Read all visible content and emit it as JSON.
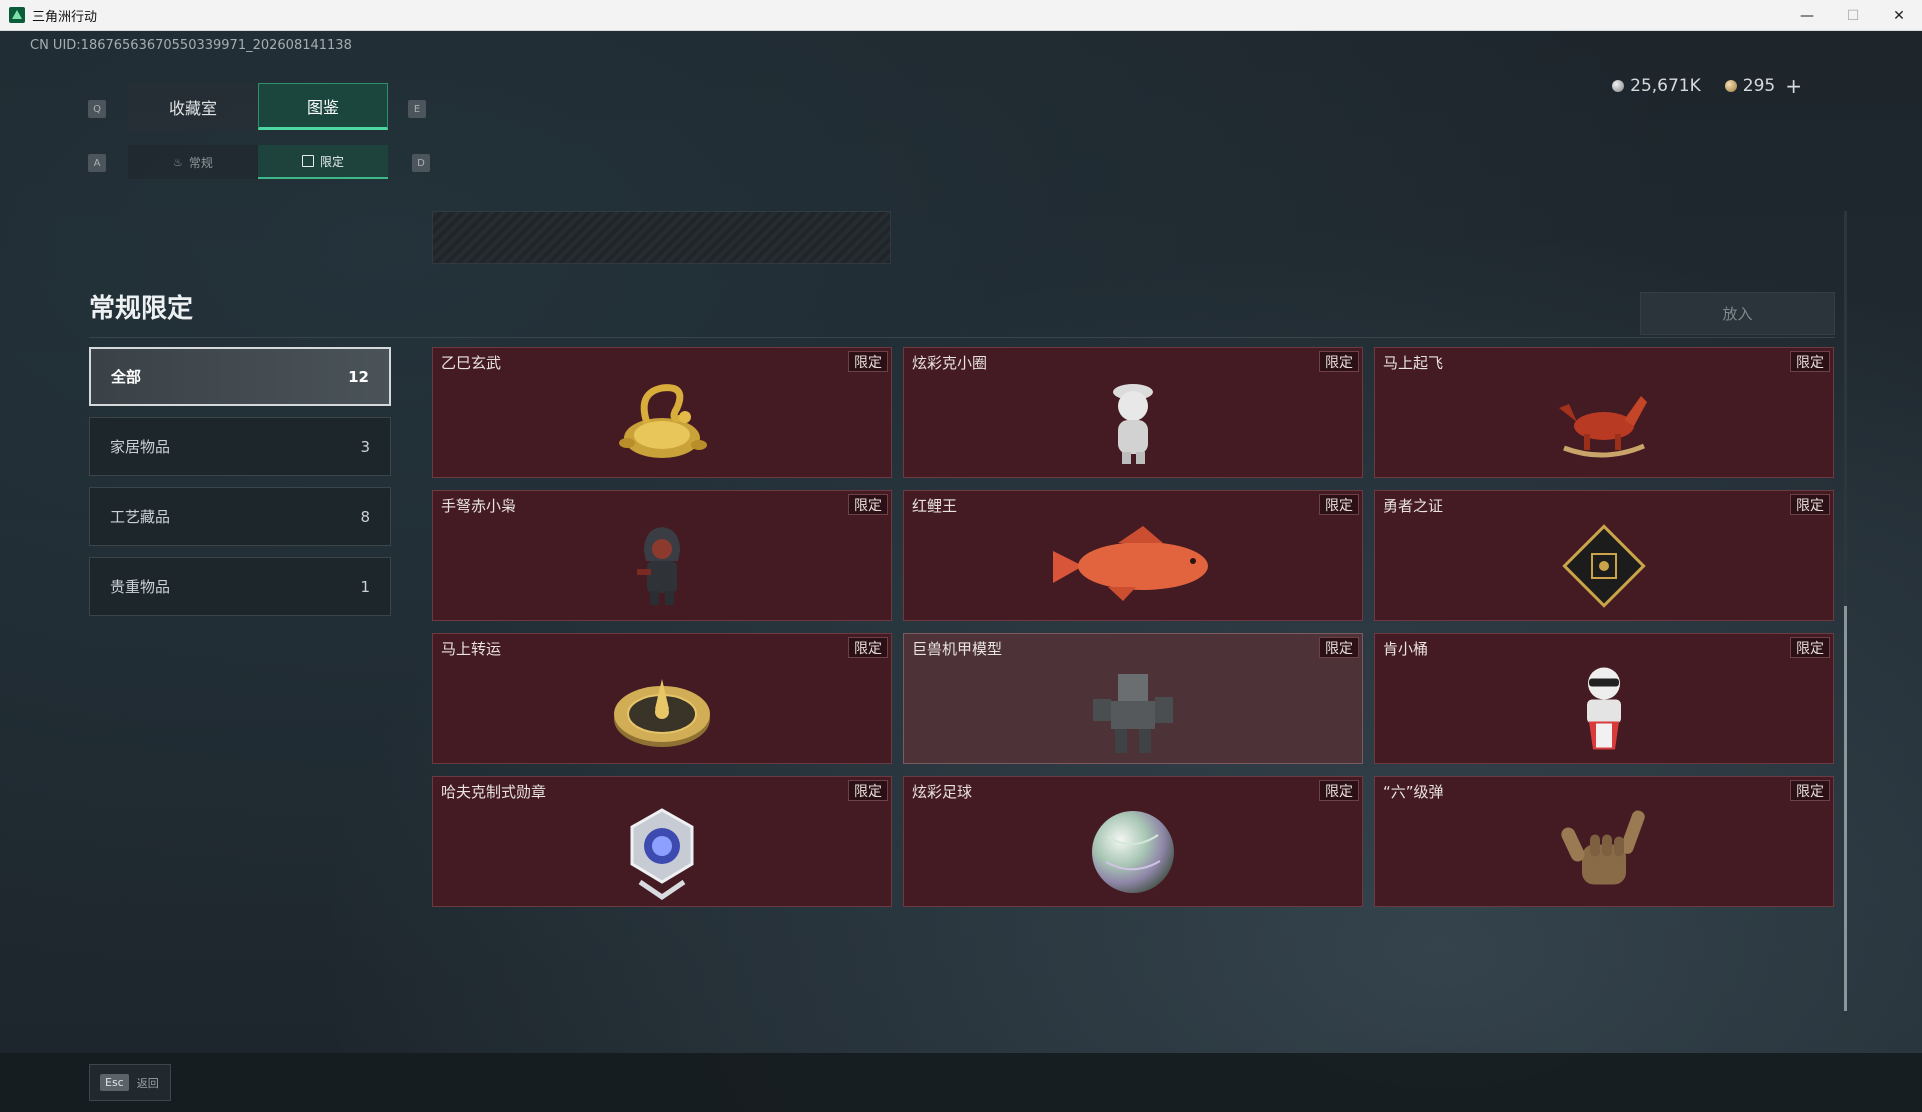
{
  "window": {
    "title": "三角洲行动",
    "minimize": "—",
    "maximize": "☐",
    "close": "✕"
  },
  "uid": "CN UID:18676563670550339971_202608141138",
  "currency": {
    "silver": "25,671K",
    "gold": "295",
    "plus": "+"
  },
  "keys": {
    "q": "Q",
    "e": "E",
    "a": "A",
    "d": "D"
  },
  "tabs": [
    {
      "label": "收藏室",
      "active": false
    },
    {
      "label": "图鉴",
      "active": true
    }
  ],
  "subtabs": [
    {
      "label": "常规",
      "icon": "flame-icon",
      "active": false
    },
    {
      "label": "限定",
      "icon": "picture-icon",
      "active": true
    }
  ],
  "section_title": "常规限定",
  "put_button": "放入",
  "categories": [
    {
      "label": "全部",
      "count": "12"
    },
    {
      "label": "家居物品",
      "count": "3"
    },
    {
      "label": "工艺藏品",
      "count": "8"
    },
    {
      "label": "贵重物品",
      "count": "1"
    }
  ],
  "badge": "限定",
  "items": [
    {
      "name": "乙巳玄武",
      "icon": "golden-turtle-snake-icon"
    },
    {
      "name": "炫彩克小圈",
      "icon": "white-figurine-icon"
    },
    {
      "name": "马上起飞",
      "icon": "red-horse-icon"
    },
    {
      "name": "手弩赤小枭",
      "icon": "hooded-figure-icon"
    },
    {
      "name": "红鲤王",
      "icon": "red-carp-icon"
    },
    {
      "name": "勇者之证",
      "icon": "diamond-card-icon"
    },
    {
      "name": "马上转运",
      "icon": "golden-wheel-icon"
    },
    {
      "name": "巨兽机甲模型",
      "icon": "mech-model-icon"
    },
    {
      "name": "肯小桶",
      "icon": "bucket-figure-icon"
    },
    {
      "name": "哈夫克制式勋章",
      "icon": "hex-medal-icon"
    },
    {
      "name": "炫彩足球",
      "icon": "iridescent-ball-icon"
    },
    {
      "name": "“六”级弹",
      "icon": "hand-sign-icon"
    }
  ],
  "back": {
    "key": "Esc",
    "label": "返回"
  }
}
